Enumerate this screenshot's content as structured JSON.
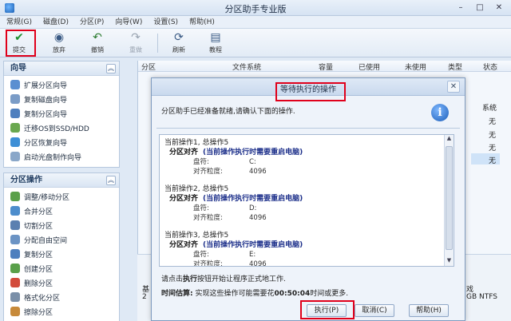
{
  "window": {
    "title": "分区助手专业版",
    "controls": [
      "–",
      "□",
      "✕"
    ]
  },
  "menu": [
    "常规(G)",
    "磁盘(D)",
    "分区(P)",
    "向导(W)",
    "设置(S)",
    "帮助(H)"
  ],
  "toolbar": {
    "buttons": [
      {
        "label": "提交",
        "icon": "commit-check-icon",
        "color": "#1e8f2e",
        "glyph": "✔"
      },
      {
        "label": "放弃",
        "icon": "discard-icon",
        "color": "#3a5a84",
        "glyph": "◉"
      },
      {
        "label": "撤销",
        "icon": "undo-icon",
        "color": "#2e7d32",
        "glyph": "↶"
      },
      {
        "label": "重做",
        "icon": "redo-icon",
        "color": "#9aa4b1",
        "glyph": "↷"
      },
      {
        "label": "刷新",
        "icon": "refresh-icon",
        "color": "#3a5a84",
        "glyph": "⟳"
      },
      {
        "label": "教程",
        "icon": "tutorial-icon",
        "color": "#3a5a84",
        "glyph": "▤"
      }
    ]
  },
  "sidebar": {
    "wizard": {
      "title": "向导",
      "items": [
        "扩展分区向导",
        "复制磁盘向导",
        "复制分区向导",
        "迁移OS到SSD/HDD",
        "分区恢复向导",
        "启动光盘制作向导"
      ]
    },
    "partition_ops": {
      "title": "分区操作",
      "items": [
        "调整/移动分区",
        "合并分区",
        "切割分区",
        "分配自由空间",
        "复制分区",
        "创建分区",
        "删除分区",
        "格式化分区",
        "擦除分区"
      ]
    }
  },
  "table": {
    "columns": [
      "分区",
      "文件系统",
      "容量",
      "已使用",
      "未使用",
      "类型",
      "状态"
    ],
    "status_values": [
      "系统",
      "无",
      "无",
      "无",
      "无"
    ]
  },
  "diskbar": {
    "left_text": "基",
    "left_sub": "2",
    "right_text": "戏",
    "right_sub": "GB NTFS"
  },
  "dialog": {
    "title": "等待执行的操作",
    "intro": "分区助手已经准备就绪,请确认下面的操作.",
    "operations": [
      {
        "header": "当前操作1, 总操作5",
        "kind": "分区对齐",
        "note": "(当前操作执行时需要重启电脑)",
        "drive_label": "盘符:",
        "drive": "C:",
        "align_label": "对齐粒度:",
        "align": "4096"
      },
      {
        "header": "当前操作2, 总操作5",
        "kind": "分区对齐",
        "note": "(当前操作执行时需要重启电脑)",
        "drive_label": "盘符:",
        "drive": "D:",
        "align_label": "对齐粒度:",
        "align": "4096"
      },
      {
        "header": "当前操作3, 总操作5",
        "kind": "分区对齐",
        "note": "(当前操作执行时需要重启电脑)",
        "drive_label": "盘符:",
        "drive": "E:",
        "align_label": "对齐粒度:",
        "align": "4096"
      }
    ],
    "hint_pre": "请点击",
    "hint_bold": "执行",
    "hint_post": "按钮开始让程序正式地工作.",
    "estimate_label": "时间估算:",
    "estimate_pre": "实现这些操作可能需要花",
    "estimate_time": "00:50:04",
    "estimate_post": "时间或更多.",
    "buttons": {
      "execute": "执行(P)",
      "cancel": "取消(C)",
      "help": "帮助(H)"
    }
  },
  "colors": {
    "highlight_box": "#e0001b",
    "accent_blue": "#1c2f8a"
  }
}
